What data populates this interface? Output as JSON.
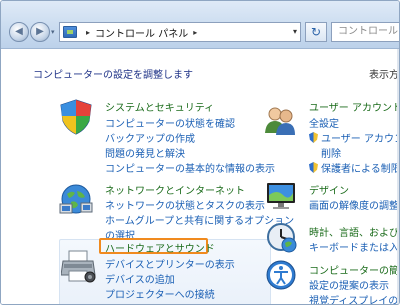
{
  "nav": {
    "back_glyph": "◀",
    "forward_glyph": "▶",
    "recent_glyph": "▾"
  },
  "address": {
    "separator": "▸",
    "location": "コントロール パネル",
    "dropdown_glyph": "▾"
  },
  "refresh_glyph": "↻",
  "search": {
    "placeholder": "コントロール"
  },
  "content": {
    "heading": "コンピューターの設定を調整します",
    "view_by": "表示方法",
    "left": [
      {
        "title": "システムとセキュリティ",
        "icon": "shield-icon",
        "tasks": [
          "コンピューターの状態を確認",
          "バックアップの作成",
          "問題の発見と解決",
          "コンピューターの基本的な情報の表示"
        ]
      },
      {
        "title": "ネットワークとインターネット",
        "icon": "network-globe-icon",
        "tasks": [
          "ネットワークの状態とタスクの表示",
          "ホームグループと共有に関するオプション",
          "の選択"
        ]
      },
      {
        "title": "ハードウェアとサウンド",
        "icon": "printer-icon",
        "tasks": [
          "デバイスとプリンターの表示",
          "デバイスの追加",
          "プロジェクターへの接続"
        ]
      }
    ],
    "right": [
      {
        "title": "ユーザー アカウントと",
        "icon": "users-icon",
        "tasks": [
          "全設定",
          "ユーザー アカウント",
          "削除",
          "保護者による制限"
        ]
      },
      {
        "title": "デザイン",
        "icon": "monitor-icon",
        "tasks": [
          "画面の解像度の調整"
        ]
      },
      {
        "title": "時計、言語、および地域",
        "icon": "clock-icon",
        "tasks": [
          "キーボードまたは入力"
        ]
      },
      {
        "title": "コンピューターの簡単操",
        "icon": "ease-of-access-icon",
        "tasks": [
          "設定の提案の表示",
          "視覚ディスプレイの最"
        ]
      }
    ]
  },
  "colors": {
    "category_title": "#1a6b1a",
    "task_link": "#1a5fb4",
    "highlight": "#f08a1e"
  }
}
